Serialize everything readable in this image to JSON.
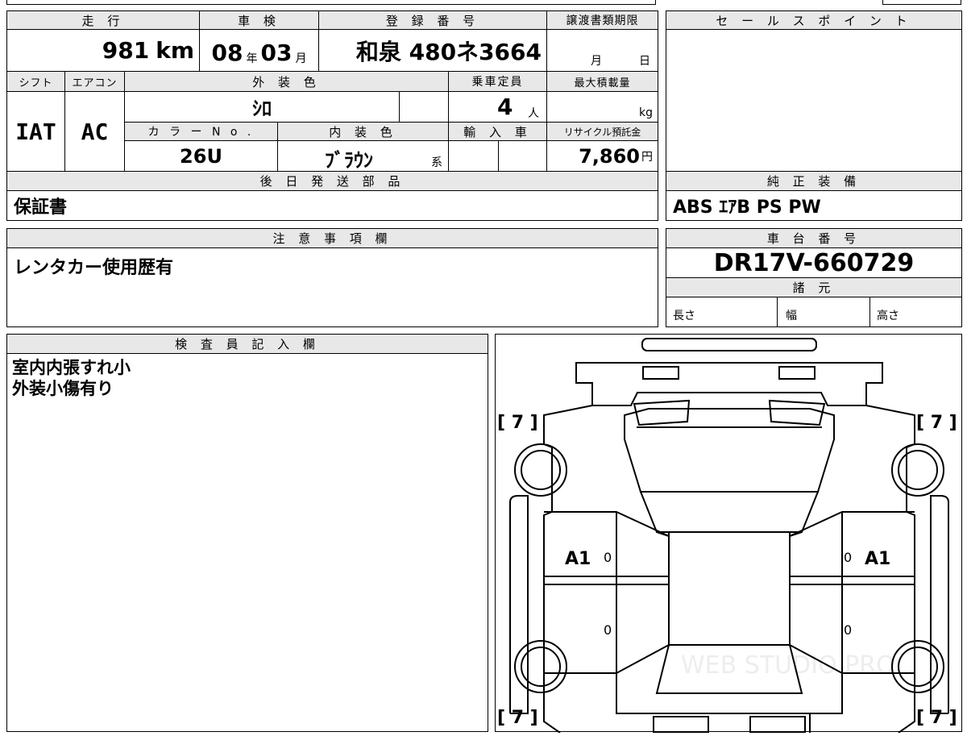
{
  "top": {
    "mileage_header": "走 行",
    "shaken_header": "車 検",
    "reg_header": "登 録 番 号",
    "transfer_header": "譲渡書類期限",
    "sales_header": "セ ー ル ス ポ イ ン ト",
    "mileage_value": "981",
    "mileage_unit": "km",
    "shaken_year": "08",
    "shaken_year_unit": "年",
    "shaken_month": "03",
    "shaken_month_unit": "月",
    "reg_number": "和泉 480ネ3664",
    "transfer_month": "月",
    "transfer_day": "日"
  },
  "row2": {
    "shift_header": "シフト",
    "ac_header": "エアコン",
    "exterior_header": "外 装 色",
    "capacity_header": "乗車定員",
    "maxload_header": "最大積載量",
    "shift_value": "IAT",
    "ac_value": "AC",
    "exterior_value": "ｼﾛ",
    "capacity_value": "4",
    "capacity_unit": "人",
    "maxload_unit": "kg",
    "colorno_header": "カ ラ ー N o .",
    "interior_header": "内 装 色",
    "import_header": "輸 入 車",
    "recycle_header": "リサイクル預託金",
    "colorno_value": "26U",
    "interior_value": "ﾌﾞﾗｳﾝ",
    "interior_suffix": "系",
    "recycle_value": "7,860",
    "recycle_unit": "円"
  },
  "later_parts": {
    "header": "後 日 発 送 部 品",
    "value": "保証書"
  },
  "genuine": {
    "header": "純 正 装 備",
    "value": "ABS ｴｱB PS PW"
  },
  "notes": {
    "header": "注 意 事 項 欄",
    "value": "レンタカー使用歴有"
  },
  "chassis": {
    "header": "車 台 番 号",
    "value": "DR17V-660729"
  },
  "specs": {
    "header": "諸 元",
    "length": "長さ",
    "width": "幅",
    "height": "高さ"
  },
  "inspector": {
    "header": "検 査 員 記 入 欄",
    "line1": "室内内張すれ小",
    "line2": "外装小傷有り"
  },
  "diagram": {
    "tire_fl": "[ 7 ]",
    "tire_fr": "[ 7 ]",
    "tire_rl": "[ 7 ]",
    "tire_rr": "[ 7 ]",
    "left_mark": "A1",
    "right_mark": "A1",
    "zero": "0",
    "watermark": "WEB STUDIO PRO"
  }
}
